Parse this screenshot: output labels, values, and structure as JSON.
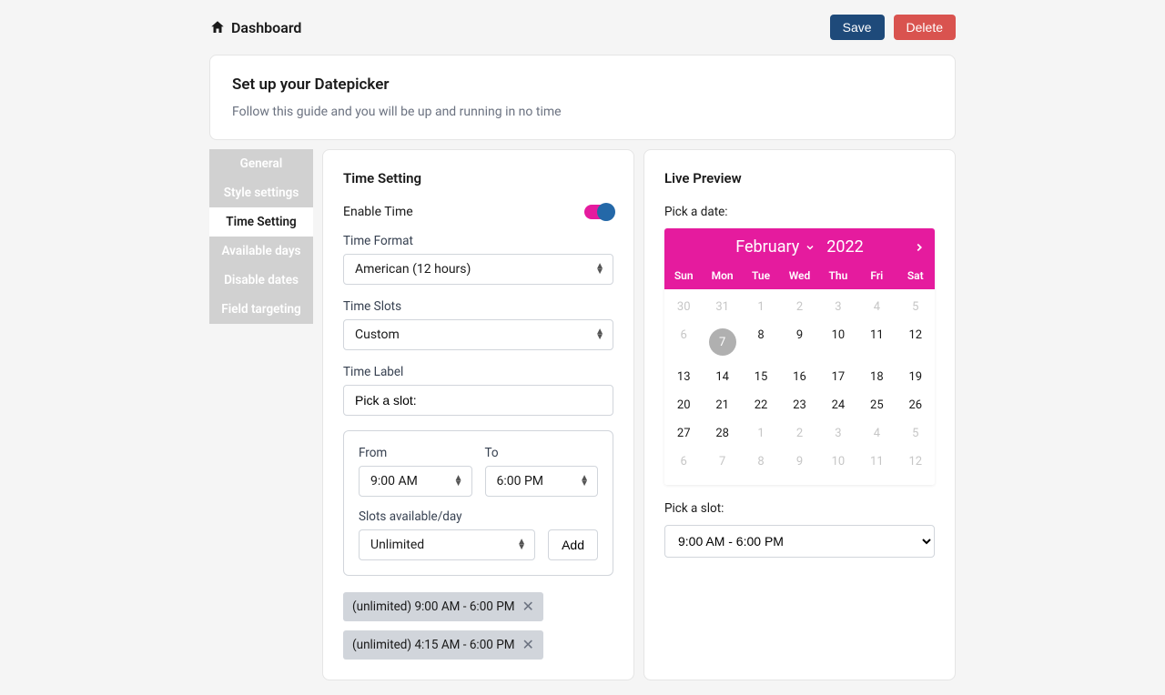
{
  "header": {
    "breadcrumb": "Dashboard",
    "save_label": "Save",
    "delete_label": "Delete"
  },
  "page_heading": {
    "title": "Set up your Datepicker",
    "subtitle": "Follow this guide and you will be up and running in no time"
  },
  "sidebar": {
    "items": [
      {
        "label": "General"
      },
      {
        "label": "Style settings"
      },
      {
        "label": "Time Setting"
      },
      {
        "label": "Available days"
      },
      {
        "label": "Disable dates"
      },
      {
        "label": "Field targeting"
      }
    ]
  },
  "time_setting": {
    "title": "Time Setting",
    "enable_time_label": "Enable Time",
    "enable_time_on": true,
    "time_format_label": "Time Format",
    "time_format_value": "American (12 hours)",
    "time_slots_label": "Time Slots",
    "time_slots_value": "Custom",
    "time_label_label": "Time Label",
    "time_label_value": "Pick a slot:",
    "from_label": "From",
    "from_value": "9:00 AM",
    "to_label": "To",
    "to_value": "6:00 PM",
    "slots_per_day_label": "Slots available/day",
    "slots_per_day_value": "Unlimited",
    "add_label": "Add",
    "chips": [
      {
        "text": "(unlimited) 9:00 AM - 6:00 PM"
      },
      {
        "text": "(unlimited) 4:15 AM - 6:00 PM"
      }
    ]
  },
  "live_preview": {
    "title": "Live Preview",
    "pick_date_label": "Pick a date:",
    "pick_slot_label": "Pick a slot:",
    "slot_value": "9:00 AM - 6:00 PM",
    "calendar": {
      "month": "February",
      "year": "2022",
      "dow": [
        "Sun",
        "Mon",
        "Tue",
        "Wed",
        "Thu",
        "Fri",
        "Sat"
      ],
      "days": [
        {
          "n": "30",
          "muted": true
        },
        {
          "n": "31",
          "muted": true
        },
        {
          "n": "1",
          "muted": true
        },
        {
          "n": "2",
          "muted": true
        },
        {
          "n": "3",
          "muted": true
        },
        {
          "n": "4",
          "muted": true
        },
        {
          "n": "5",
          "muted": true
        },
        {
          "n": "6",
          "muted": true
        },
        {
          "n": "7",
          "today": true
        },
        {
          "n": "8"
        },
        {
          "n": "9"
        },
        {
          "n": "10"
        },
        {
          "n": "11"
        },
        {
          "n": "12"
        },
        {
          "n": "13"
        },
        {
          "n": "14"
        },
        {
          "n": "15"
        },
        {
          "n": "16"
        },
        {
          "n": "17"
        },
        {
          "n": "18"
        },
        {
          "n": "19"
        },
        {
          "n": "20"
        },
        {
          "n": "21"
        },
        {
          "n": "22"
        },
        {
          "n": "23"
        },
        {
          "n": "24"
        },
        {
          "n": "25"
        },
        {
          "n": "26"
        },
        {
          "n": "27"
        },
        {
          "n": "28"
        },
        {
          "n": "1",
          "muted": true
        },
        {
          "n": "2",
          "muted": true
        },
        {
          "n": "3",
          "muted": true
        },
        {
          "n": "4",
          "muted": true
        },
        {
          "n": "5",
          "muted": true
        },
        {
          "n": "6",
          "muted": true
        },
        {
          "n": "7",
          "muted": true
        },
        {
          "n": "8",
          "muted": true
        },
        {
          "n": "9",
          "muted": true
        },
        {
          "n": "10",
          "muted": true
        },
        {
          "n": "11",
          "muted": true
        },
        {
          "n": "12",
          "muted": true
        }
      ]
    }
  },
  "colors": {
    "accent": "#e51b9e",
    "primary": "#1e4a7a",
    "danger": "#d9534f"
  }
}
